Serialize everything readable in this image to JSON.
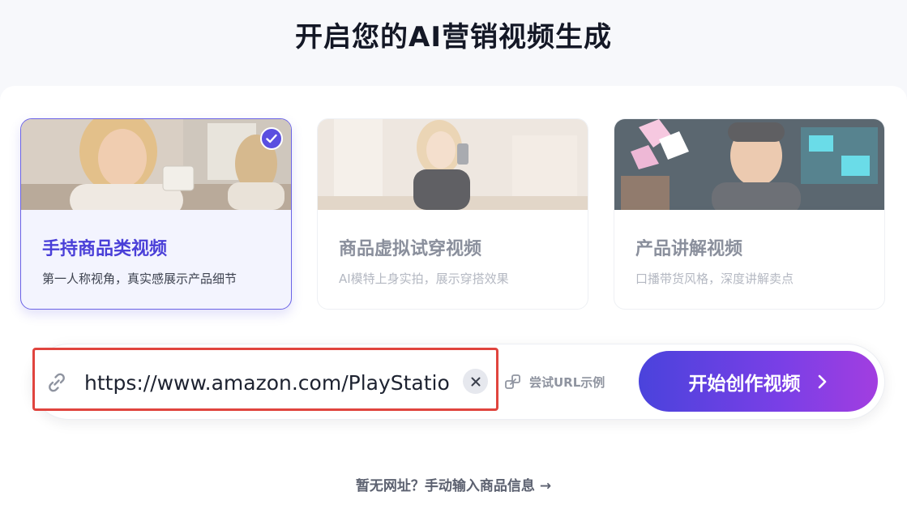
{
  "page": {
    "title": "开启您的AI营销视频生成"
  },
  "cards": [
    {
      "title": "手持商品类视频",
      "description": "第一人称视角，真实感展示产品细节",
      "selected": true
    },
    {
      "title": "商品虚拟试穿视频",
      "description": "AI模特上身实拍，展示穿搭效果",
      "selected": false
    },
    {
      "title": "产品讲解视频",
      "description": "口播带货风格，深度讲解卖点",
      "selected": false
    }
  ],
  "url_input": {
    "value": "https://www.amazon.com/PlayStatio",
    "icon": "link-icon"
  },
  "example_link": {
    "label": "尝试URL示例",
    "icon": "share-link-icon"
  },
  "start_button": {
    "label": "开始创作视频",
    "icon": "chevron-right-icon"
  },
  "manual_entry": {
    "label": "暂无网址？手动输入商品信息 →"
  },
  "colors": {
    "accent": "#5a4fe0",
    "highlight_border": "#e0443e",
    "button_gradient_start": "#4a43dc",
    "button_gradient_end": "#a23ee0"
  }
}
